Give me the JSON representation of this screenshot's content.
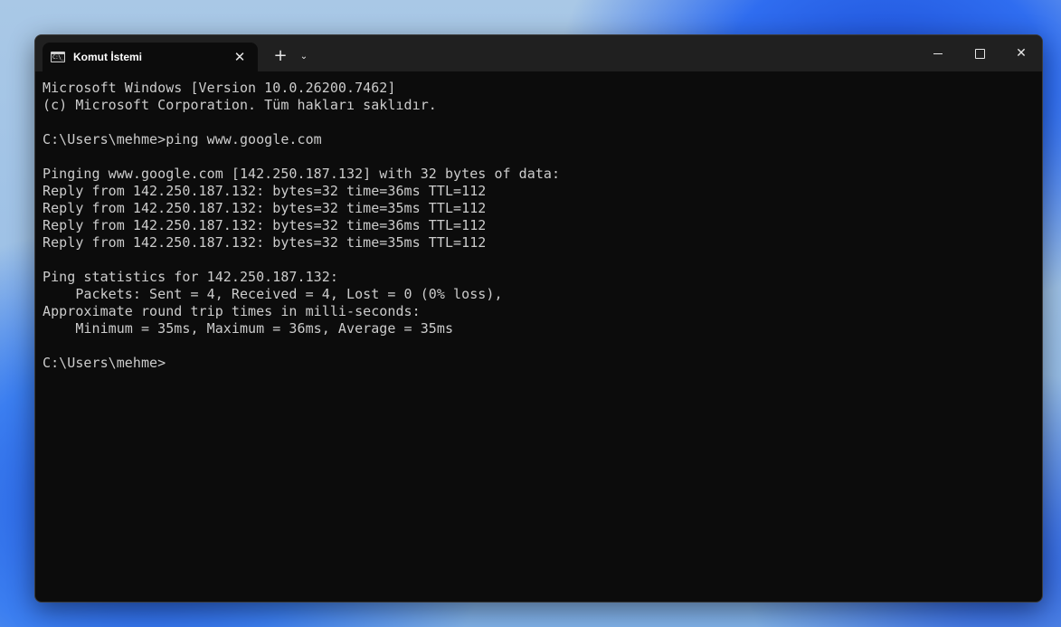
{
  "window": {
    "tab": {
      "title": "Komut İstemi",
      "icon": "cmd-icon",
      "icon_glyph": "C:\\_",
      "close_glyph": "✕"
    },
    "new_tab_glyph": "+",
    "dropdown_glyph": "⌄",
    "controls": {
      "close_glyph": "✕"
    }
  },
  "console": {
    "lines": [
      "Microsoft Windows [Version 10.0.26200.7462]",
      "(c) Microsoft Corporation. Tüm hakları saklıdır.",
      "",
      "C:\\Users\\mehme>ping www.google.com",
      "",
      "Pinging www.google.com [142.250.187.132] with 32 bytes of data:",
      "Reply from 142.250.187.132: bytes=32 time=36ms TTL=112",
      "Reply from 142.250.187.132: bytes=32 time=35ms TTL=112",
      "Reply from 142.250.187.132: bytes=32 time=36ms TTL=112",
      "Reply from 142.250.187.132: bytes=32 time=35ms TTL=112",
      "",
      "Ping statistics for 142.250.187.132:",
      "    Packets: Sent = 4, Received = 4, Lost = 0 (0% loss),",
      "Approximate round trip times in milli-seconds:",
      "    Minimum = 35ms, Maximum = 36ms, Average = 35ms",
      "",
      "C:\\Users\\mehme>"
    ]
  },
  "colors": {
    "console_bg": "#0c0c0c",
    "console_fg": "#cccccc",
    "titlebar_bg": "#202020"
  }
}
